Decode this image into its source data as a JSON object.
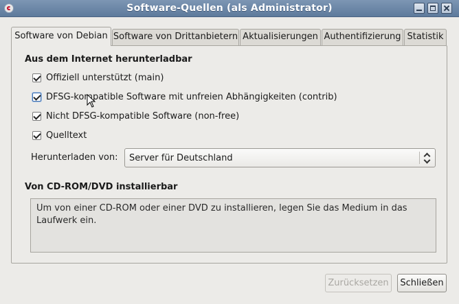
{
  "window": {
    "title": "Software-Quellen (als Administrator)"
  },
  "tabs": [
    {
      "label": "Software von Debian",
      "active": true
    },
    {
      "label": "Software von Drittanbietern",
      "active": false
    },
    {
      "label": "Aktualisierungen",
      "active": false
    },
    {
      "label": "Authentifizierung",
      "active": false
    },
    {
      "label": "Statistik",
      "active": false
    }
  ],
  "internet": {
    "heading": "Aus dem Internet herunterladbar",
    "components": [
      {
        "label": "Offiziell unterstützt (main)",
        "checked": true
      },
      {
        "label": "DFSG-kompatible Software mit unfreien Abhängigkeiten (contrib)",
        "checked": true
      },
      {
        "label": "Nicht DFSG-kompatible Software (non-free)",
        "checked": true
      },
      {
        "label": "Quelltext",
        "checked": true
      }
    ],
    "download_from_label": "Herunterladen von:",
    "download_from_value": "Server für Deutschland"
  },
  "cdrom": {
    "heading": "Von CD-ROM/DVD installierbar",
    "text": "Um von einer CD-ROM oder einer DVD zu installieren, legen Sie das Medium in das Laufwerk ein."
  },
  "buttons": {
    "revert_label": "Zurücksetzen",
    "revert_enabled": false,
    "close_label": "Schließen"
  },
  "icons": {
    "app": "debian-swirl-icon",
    "minimize": "minimize-icon",
    "maximize": "maximize-icon",
    "close": "close-icon",
    "combo": "updown-arrows-icon",
    "pointer": "mouse-pointer-icon"
  }
}
